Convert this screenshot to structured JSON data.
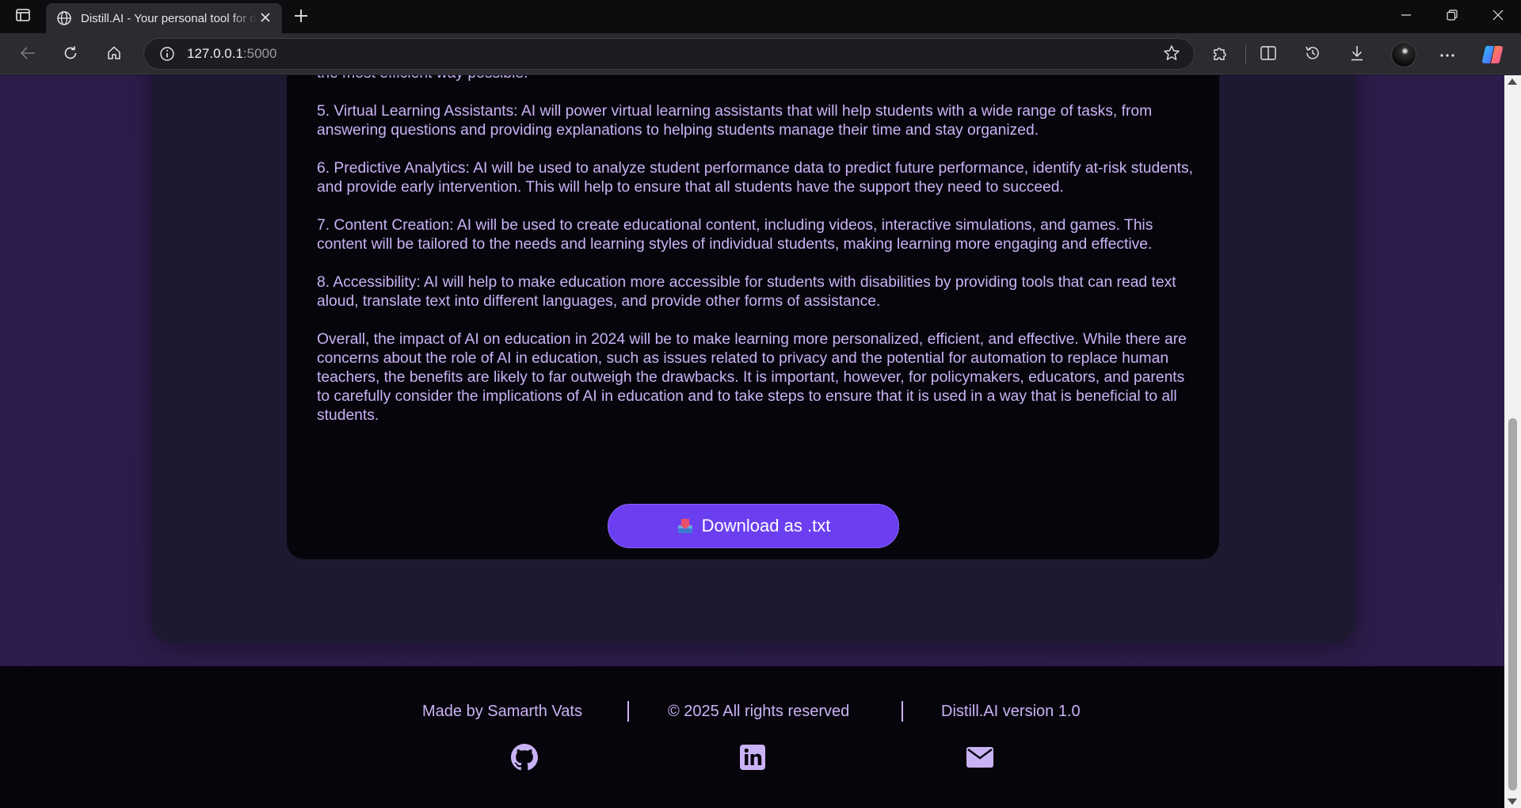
{
  "browser": {
    "tab_title": "Distill.AI - Your personal tool for distilling",
    "url_host": "127.0.0.1",
    "url_port": ":5000",
    "icons": [
      "sidebar-icon",
      "globe-icon",
      "close-icon",
      "plus-icon",
      "minimize-icon",
      "restore-icon",
      "window-close-icon",
      "back-icon",
      "refresh-icon",
      "home-icon",
      "info-icon",
      "star-icon",
      "extensions-icon",
      "split-screen-icon",
      "history-icon",
      "download-icon",
      "more-icon",
      "copilot-icon"
    ]
  },
  "summary": {
    "paragraphs": [
      "the most efficient way possible.",
      "5. Virtual Learning Assistants: AI will power virtual learning assistants that will help students with a wide range of tasks, from answering questions and providing explanations to helping students manage their time and stay organized.",
      "6. Predictive Analytics: AI will be used to analyze student performance data to predict future performance, identify at-risk students, and provide early intervention. This will help to ensure that all students have the support they need to succeed.",
      "7. Content Creation: AI will be used to create educational content, including videos, interactive simulations, and games. This content will be tailored to the needs and learning styles of individual students, making learning more engaging and effective.",
      "8. Accessibility: AI will help to make education more accessible for students with disabilities by providing tools that can read text aloud, translate text into different languages, and provide other forms of assistance.",
      "Overall, the impact of AI on education in 2024 will be to make learning more personalized, efficient, and effective. While there are concerns about the role of AI in education, such as issues related to privacy and the potential for automation to replace human teachers, the benefits are likely to far outweigh the drawbacks. It is important, however, for policymakers, educators, and parents to carefully consider the implications of AI in education and to take steps to ensure that it is used in a way that is beneficial to all students."
    ]
  },
  "download": {
    "label": "Download as .txt",
    "icon": "inbox-tray-icon"
  },
  "footer": {
    "made_by": "Made by Samarth Vats",
    "rights": "© 2025 All rights reserved",
    "version": "Distill.AI version 1.0",
    "social": [
      "github-icon",
      "linkedin-icon",
      "mail-icon"
    ]
  },
  "colors": {
    "accent": "#6b3ff0",
    "text": "#c9b3f5",
    "page_bg": "#2d1b4c",
    "panel_bg": "#07050c"
  }
}
